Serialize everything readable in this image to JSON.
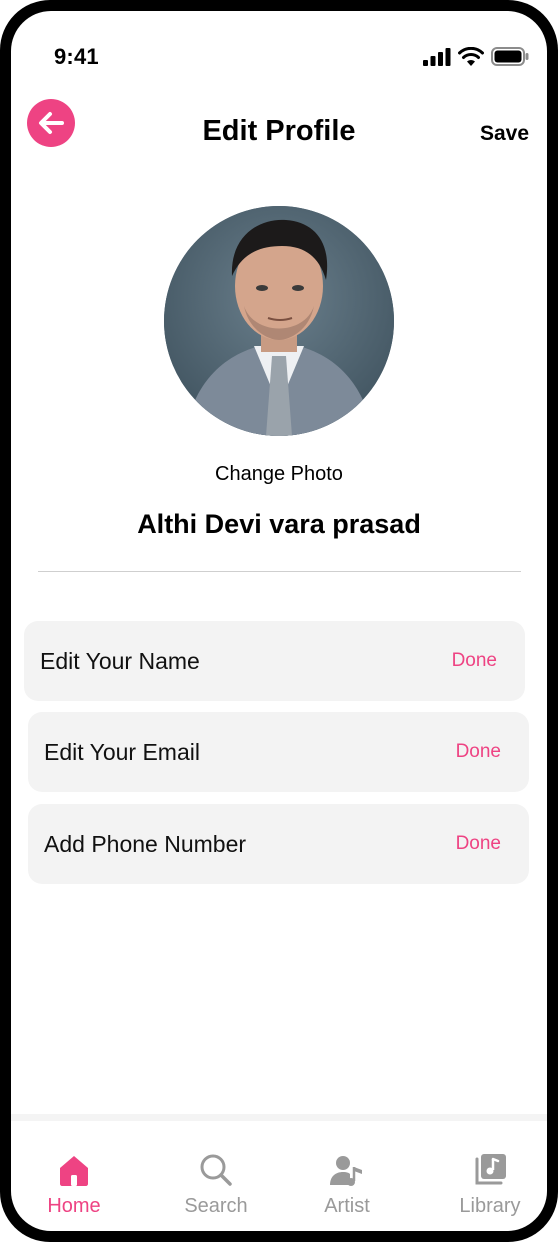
{
  "status_bar": {
    "time": "9:41"
  },
  "header": {
    "title": "Edit Profile",
    "save_label": "Save"
  },
  "profile": {
    "change_photo_label": "Change Photo",
    "name": "Althi Devi vara prasad"
  },
  "edit_rows": [
    {
      "label": "Edit Your Name",
      "action": "Done"
    },
    {
      "label": "Edit Your Email",
      "action": "Done"
    },
    {
      "label": "Add Phone Number",
      "action": "Done"
    }
  ],
  "bottom_nav": [
    {
      "label": "Home",
      "icon": "home-icon",
      "active": true
    },
    {
      "label": "Search",
      "icon": "search-icon",
      "active": false
    },
    {
      "label": "Artist",
      "icon": "artist-icon",
      "active": false
    },
    {
      "label": "Library",
      "icon": "library-icon",
      "active": false
    }
  ],
  "colors": {
    "accent": "#ee4383",
    "row_background": "#f3f3f3",
    "inactive_nav": "#9a9a9a"
  }
}
